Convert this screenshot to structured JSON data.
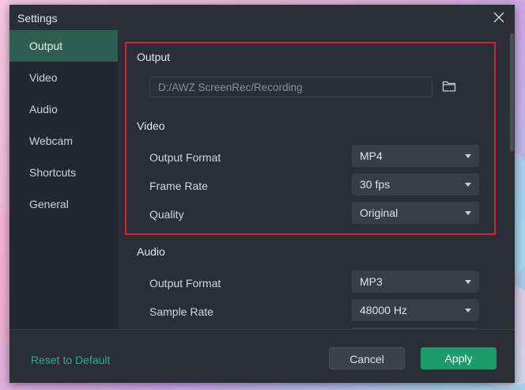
{
  "window": {
    "title": "Settings"
  },
  "sidebar": {
    "items": [
      {
        "label": "Output",
        "active": true
      },
      {
        "label": "Video",
        "active": false
      },
      {
        "label": "Audio",
        "active": false
      },
      {
        "label": "Webcam",
        "active": false
      },
      {
        "label": "Shortcuts",
        "active": false
      },
      {
        "label": "General",
        "active": false
      }
    ]
  },
  "output": {
    "section_title": "Output",
    "path_value": "D:/AWZ ScreenRec/Recording",
    "folder_icon": "folder-icon"
  },
  "video": {
    "section_title": "Video",
    "format_label": "Output Format",
    "format_value": "MP4",
    "frame_rate_label": "Frame Rate",
    "frame_rate_value": "30 fps",
    "quality_label": "Quality",
    "quality_value": "Original"
  },
  "audio": {
    "section_title": "Audio",
    "format_label": "Output Format",
    "format_value": "MP3",
    "sample_rate_label": "Sample Rate",
    "sample_rate_value": "48000 Hz"
  },
  "footer": {
    "reset_label": "Reset to Default",
    "cancel_label": "Cancel",
    "apply_label": "Apply"
  },
  "colors": {
    "accent": "#1b9a6e",
    "link": "#22b38a",
    "highlight_border": "#d4232c",
    "active_sidebar": "#2e5e50"
  }
}
